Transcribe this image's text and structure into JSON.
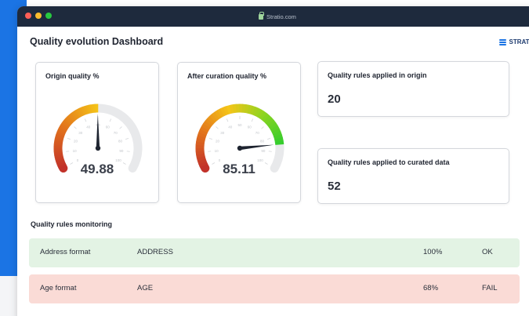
{
  "window": {
    "url": "Stratio.com"
  },
  "header": {
    "title": "Quality evolution Dashboard",
    "brand": "STRATIO"
  },
  "gauges": [
    {
      "title": "Origin quality %",
      "value": 49.88,
      "display": "49.88",
      "max": 100,
      "colors": [
        "#c2322a",
        "#e2741c",
        "#f5c518"
      ]
    },
    {
      "title": "After curation quality %",
      "value": 85.11,
      "display": "85.11",
      "max": 100,
      "colors": [
        "#c2322a",
        "#e2741c",
        "#f5c518",
        "#8cd420",
        "#2ecc2e"
      ]
    }
  ],
  "stats": [
    {
      "title": "Quality rules applied in origin",
      "value": "20"
    },
    {
      "title": "Quality rules applied to curated data",
      "value": "52"
    }
  ],
  "monitoring": {
    "title": "Quality rules monitoring",
    "rows": [
      {
        "name": "Address format",
        "field": "ADDRESS",
        "percent": "100%",
        "status": "OK"
      },
      {
        "name": "Age format",
        "field": "AGE",
        "percent": "68%",
        "status": "FAIL"
      }
    ]
  },
  "colors": {
    "accent": "#1b74e4",
    "titlebar": "#1e2a3d",
    "ok_row": "#e3f3e4",
    "fail_row": "#fadbd6"
  }
}
